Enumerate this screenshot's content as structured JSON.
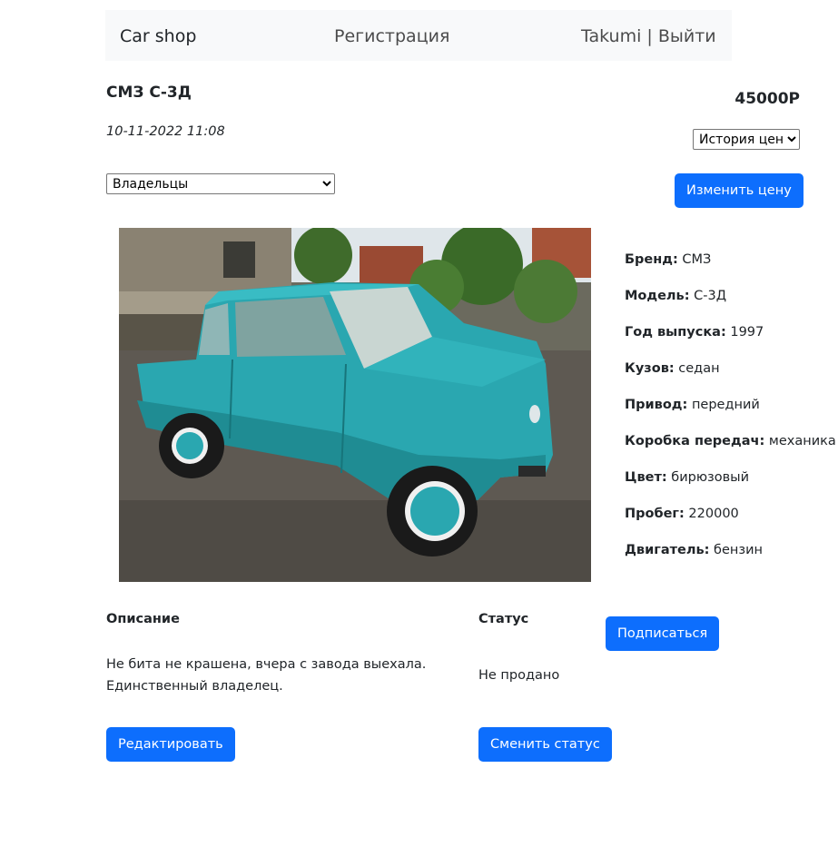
{
  "nav": {
    "brand": "Car shop",
    "register": "Регистрация",
    "user": "Takumi",
    "separator": "|",
    "logout": "Выйти"
  },
  "car": {
    "title": "СМЗ С-3Д",
    "price": "45000Р",
    "date": "10-11-2022 11:08"
  },
  "controls": {
    "owners_select": "Владельцы",
    "price_history_select": "История цен",
    "change_price": "Изменить цену"
  },
  "specs": [
    {
      "label": "Бренд:",
      "value": "СМЗ"
    },
    {
      "label": "Модель:",
      "value": "С-3Д"
    },
    {
      "label": "Год выпуска:",
      "value": "1997"
    },
    {
      "label": "Кузов:",
      "value": "седан"
    },
    {
      "label": "Привод:",
      "value": "передний"
    },
    {
      "label": "Коробка передач:",
      "value": "механика"
    },
    {
      "label": "Цвет:",
      "value": "бирюзовый"
    },
    {
      "label": "Пробег:",
      "value": "220000"
    },
    {
      "label": "Двигатель:",
      "value": "бензин"
    }
  ],
  "description": {
    "heading": "Описание",
    "line1": "Не бита не крашена, вчера с завода выехала.",
    "line2": "Единственный владелец.",
    "edit_button": "Редактировать"
  },
  "status": {
    "heading": "Статус",
    "value": "Не продано",
    "subscribe_button": "Подписаться",
    "change_button": "Сменить статус"
  },
  "colors": {
    "primary": "#0d6efd",
    "navbar_bg": "#f8f9fa",
    "car_body": "#2aa7b0"
  }
}
